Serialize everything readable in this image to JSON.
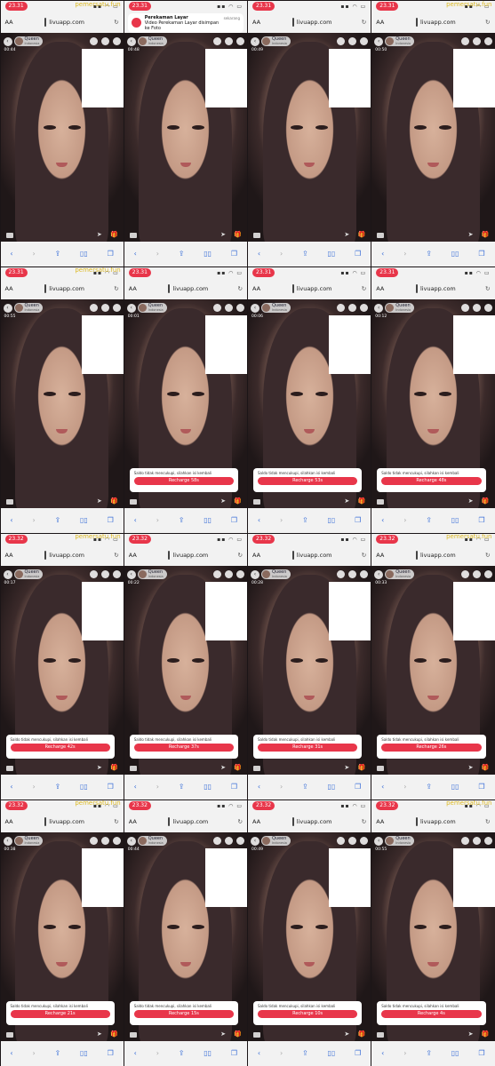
{
  "browser": {
    "url": "livuapp.com",
    "aa_label": "AA"
  },
  "streamer": {
    "name": "Queen",
    "sub": "Indonesia"
  },
  "watermark": "pemersatu.fun",
  "recording_banner": {
    "title": "Perekaman Layar",
    "message": "Video Perekaman Layar disimpan ke Foto",
    "when": "sekarang"
  },
  "dialog_message": "Saldo tidak mencukupi, silahkan isi kembali",
  "colors": {
    "accent": "#e8364a",
    "toolbar_icon": "#3a6fd8"
  },
  "tiles": [
    {
      "time": "23.31",
      "timer": "00:44",
      "recharge": null
    },
    {
      "time": "23.31",
      "timer": "00:48",
      "recharge": null,
      "banner": true
    },
    {
      "time": "23.31",
      "timer": "00:49",
      "recharge": null
    },
    {
      "time": "23.31",
      "timer": "00:50",
      "recharge": null
    },
    {
      "time": "23.31",
      "timer": "00:55",
      "recharge": null
    },
    {
      "time": "23.31",
      "timer": "00:01",
      "recharge": "Recharge 58s"
    },
    {
      "time": "23.31",
      "timer": "00:06",
      "recharge": "Recharge 53s"
    },
    {
      "time": "23.31",
      "timer": "00:12",
      "recharge": "Recharge 48s"
    },
    {
      "time": "23.32",
      "timer": "00:17",
      "recharge": "Recharge 42s"
    },
    {
      "time": "23.32",
      "timer": "00:22",
      "recharge": "Recharge 37s"
    },
    {
      "time": "23.32",
      "timer": "00:28",
      "recharge": "Recharge 31s"
    },
    {
      "time": "23.32",
      "timer": "00:33",
      "recharge": "Recharge 26s"
    },
    {
      "time": "23.32",
      "timer": "00:38",
      "recharge": "Recharge 21s"
    },
    {
      "time": "23.32",
      "timer": "00:44",
      "recharge": "Recharge 15s"
    },
    {
      "time": "23.32",
      "timer": "00:49",
      "recharge": "Recharge 10s"
    },
    {
      "time": "23.32",
      "timer": "00:55",
      "recharge": "Recharge 4s"
    }
  ]
}
